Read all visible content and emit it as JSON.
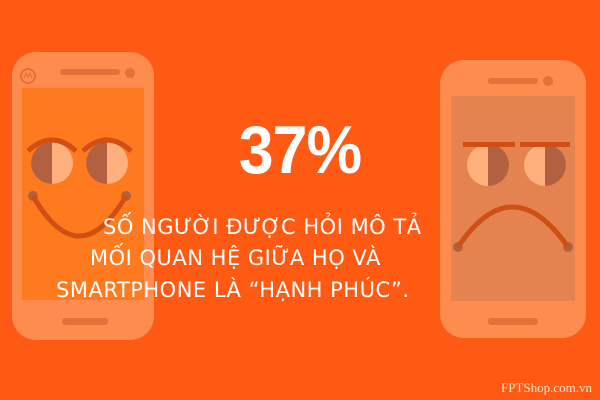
{
  "headline": {
    "percent": "37%"
  },
  "caption": {
    "line1": "SỐ NGƯỜI ĐƯỢC HỎI MÔ TẢ",
    "line2": "MỐI QUAN HỆ GIỮA HỌ VÀ",
    "line3": "SMARTPHONE LÀ “HẠNH PHÚC”."
  },
  "watermark": {
    "text": "FPTShop.com.vn"
  },
  "colors": {
    "background": "#FF5A14",
    "phone_body": "#FF8C4F",
    "happy_screen": "#FF7A1E",
    "sad_screen": "#E4834F",
    "text": "#FFFFFF"
  },
  "icons": {
    "left_phone": "happy-phone-icon",
    "right_phone": "sad-phone-icon",
    "brand_logo": "motorola-logo-icon"
  }
}
